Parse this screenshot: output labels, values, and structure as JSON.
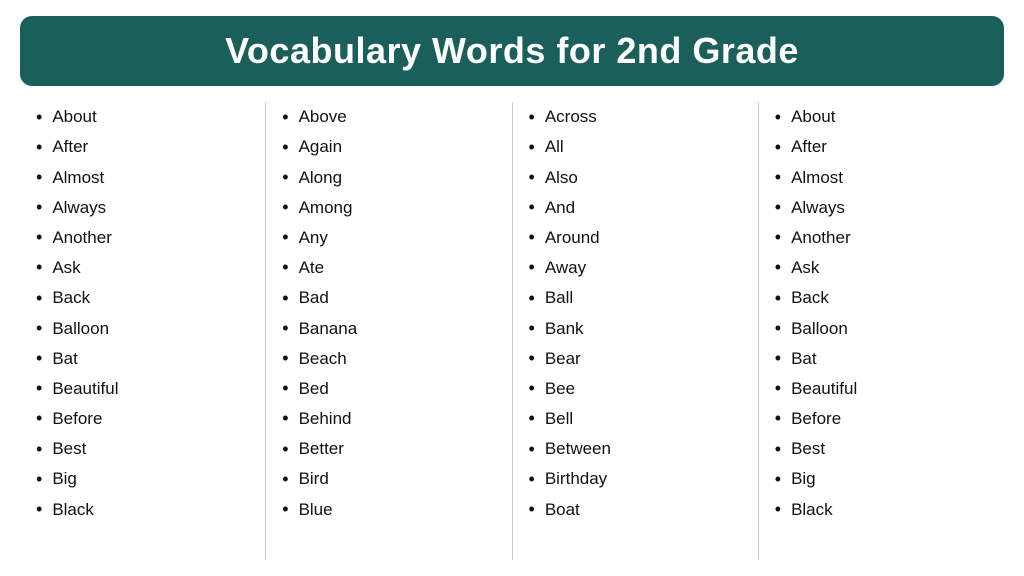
{
  "title": "Vocabulary Words for 2nd Grade",
  "columns": [
    {
      "id": "col1",
      "words": [
        "About",
        "After",
        "Almost",
        "Always",
        "Another",
        "Ask",
        "Back",
        "Balloon",
        "Bat",
        "Beautiful",
        "Before",
        "Best",
        "Big",
        "Black"
      ]
    },
    {
      "id": "col2",
      "words": [
        "Above",
        "Again",
        "Along",
        "Among",
        "Any",
        "Ate",
        "Bad",
        "Banana",
        "Beach",
        "Bed",
        "Behind",
        "Better",
        "Bird",
        "Blue"
      ]
    },
    {
      "id": "col3",
      "words": [
        "Across",
        "All",
        "Also",
        "And",
        "Around",
        "Away",
        "Ball",
        "Bank",
        "Bear",
        "Bee",
        "Bell",
        "Between",
        "Birthday",
        "Boat"
      ]
    },
    {
      "id": "col4",
      "words": [
        "About",
        "After",
        "Almost",
        "Always",
        "Another",
        "Ask",
        "Back",
        "Balloon",
        "Bat",
        "Beautiful",
        "Before",
        "Best",
        "Big",
        "Black"
      ]
    }
  ]
}
